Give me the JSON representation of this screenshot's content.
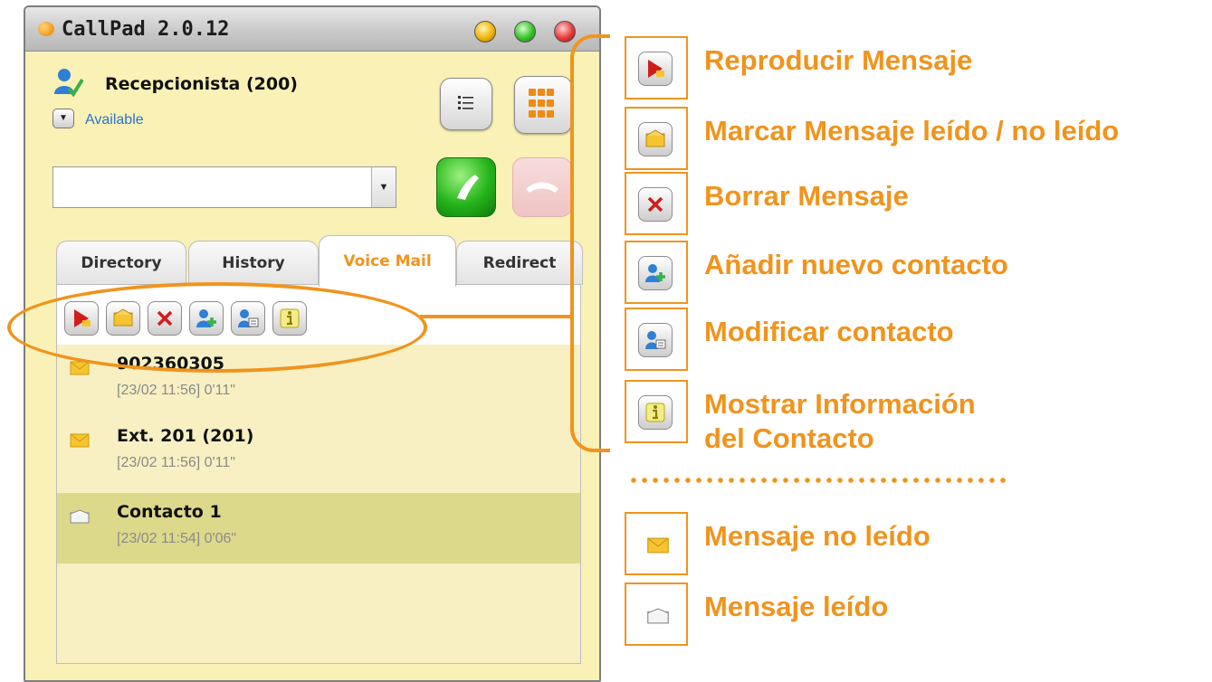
{
  "window": {
    "title": "CallPad 2.0.12",
    "user_name": "Recepcionista (200)",
    "status": "Available"
  },
  "tabs": [
    {
      "label": "Directory"
    },
    {
      "label": "History"
    },
    {
      "label": "Voice Mail",
      "active": true
    },
    {
      "label": "Redirect"
    }
  ],
  "messages": [
    {
      "number": "902360305",
      "meta": "[23/02 11:56] 0'11\"",
      "read": false,
      "selected": false
    },
    {
      "number": "Ext. 201 (201)",
      "meta": "[23/02 11:56] 0'11\"",
      "read": false,
      "selected": false
    },
    {
      "number": "Contacto 1",
      "meta": "[23/02 11:54] 0'06\"",
      "read": true,
      "selected": true
    }
  ],
  "legend": [
    {
      "icon": "play-message-icon",
      "label": "Reproducir Mensaje"
    },
    {
      "icon": "mark-read-icon",
      "label": "Marcar Mensaje leído / no leído"
    },
    {
      "icon": "delete-icon",
      "label": "Borrar Mensaje"
    },
    {
      "icon": "add-contact-icon",
      "label": "Añadir nuevo contacto"
    },
    {
      "icon": "edit-contact-icon",
      "label": "Modificar contacto"
    },
    {
      "icon": "info-icon",
      "label_line1": "Mostrar Información",
      "label_line2": "del Contacto"
    },
    {
      "icon": "unread-envelope-icon",
      "label": "Mensaje no leído"
    },
    {
      "icon": "read-envelope-icon",
      "label": "Mensaje leído"
    }
  ],
  "colors": {
    "accent": "#f0941d",
    "panel": "#f9f1b6",
    "selected_row": "#ddd98a",
    "status_link": "#2b72c9"
  }
}
